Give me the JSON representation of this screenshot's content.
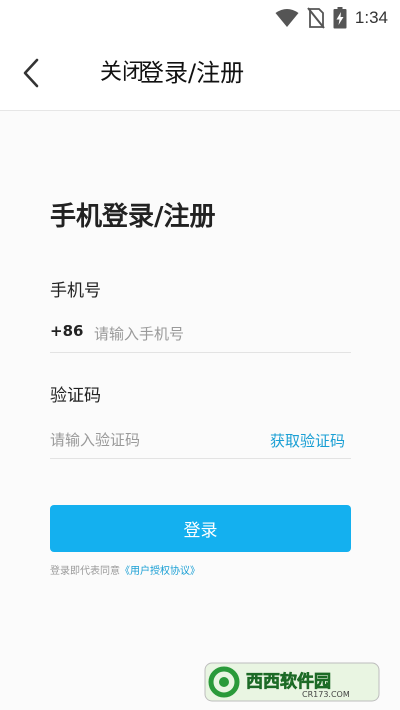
{
  "status_bar": {
    "time": "1:34",
    "icons": [
      "wifi-icon",
      "no-sim-icon",
      "battery-charging-icon"
    ]
  },
  "nav": {
    "back_icon": "chevron-left-icon",
    "close_label": "关闭",
    "title": "登录/注册"
  },
  "form": {
    "heading": "手机登录/注册",
    "phone_label": "手机号",
    "country_code": "+86",
    "phone_placeholder": "请输入手机号",
    "phone_value": "",
    "code_label": "验证码",
    "code_placeholder": "请输入验证码",
    "code_value": "",
    "get_code_label": "获取验证码",
    "login_label": "登录",
    "agreement_prefix": "登录即代表同意",
    "agreement_link": "《用户授权协议》"
  },
  "watermark": {
    "brand": "西西软件园",
    "url": "CR173.COM"
  },
  "colors": {
    "accent": "#14b0ef",
    "link": "#1a9fd4",
    "placeholder": "#9a9a9a",
    "divider": "#e3e3e3"
  }
}
